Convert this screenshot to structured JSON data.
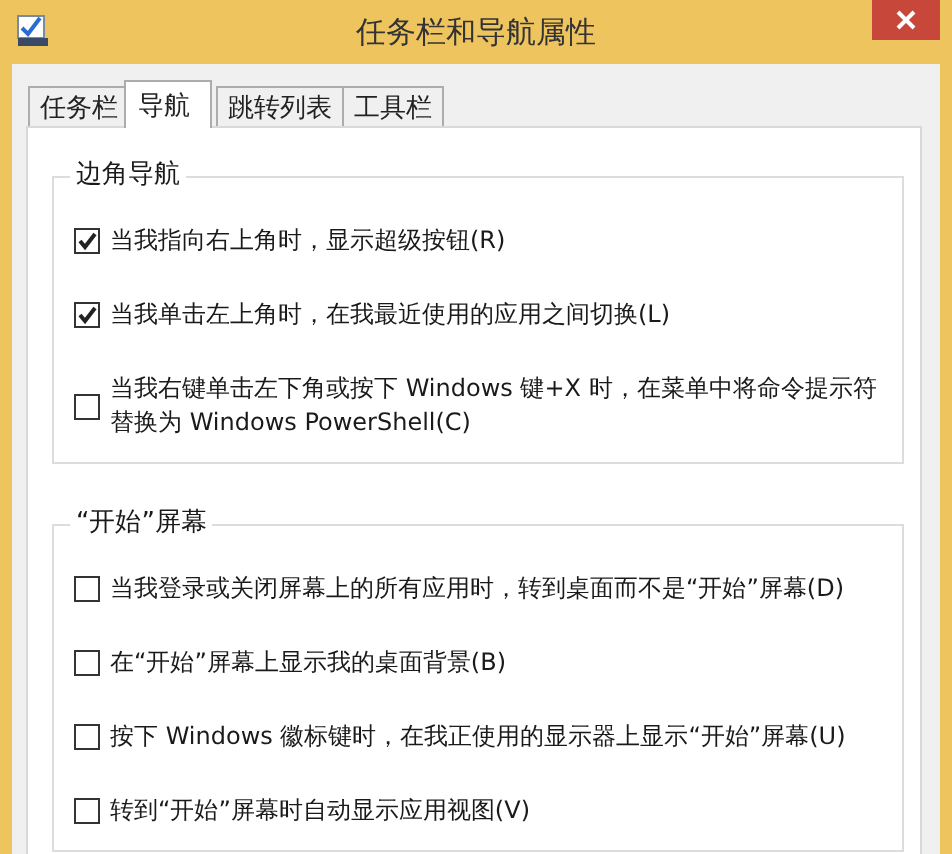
{
  "window": {
    "title": "任务栏和导航属性"
  },
  "tabs": [
    {
      "label": "任务栏",
      "selected": false
    },
    {
      "label": "导航",
      "selected": true
    },
    {
      "label": "跳转列表",
      "selected": false
    },
    {
      "label": "工具栏",
      "selected": false
    }
  ],
  "groups": [
    {
      "title": "边角导航",
      "options": [
        {
          "label": "当我指向右上角时，显示超级按钮(R)",
          "checked": true
        },
        {
          "label": "当我单击左上角时，在我最近使用的应用之间切换(L)",
          "checked": true
        },
        {
          "label": "当我右键单击左下角或按下 Windows 键+X 时，在菜单中将命令提示符替换为 Windows PowerShell(C)",
          "checked": false
        }
      ]
    },
    {
      "title": "“开始”屏幕",
      "options": [
        {
          "label": "当我登录或关闭屏幕上的所有应用时，转到桌面而不是“开始”屏幕(D)",
          "checked": false
        },
        {
          "label": "在“开始”屏幕上显示我的桌面背景(B)",
          "checked": false
        },
        {
          "label": "按下 Windows 徽标键时，在我正使用的显示器上显示“开始”屏幕(U)",
          "checked": false
        },
        {
          "label": "转到“开始”屏幕时自动显示应用视图(V)",
          "checked": false
        }
      ]
    }
  ]
}
